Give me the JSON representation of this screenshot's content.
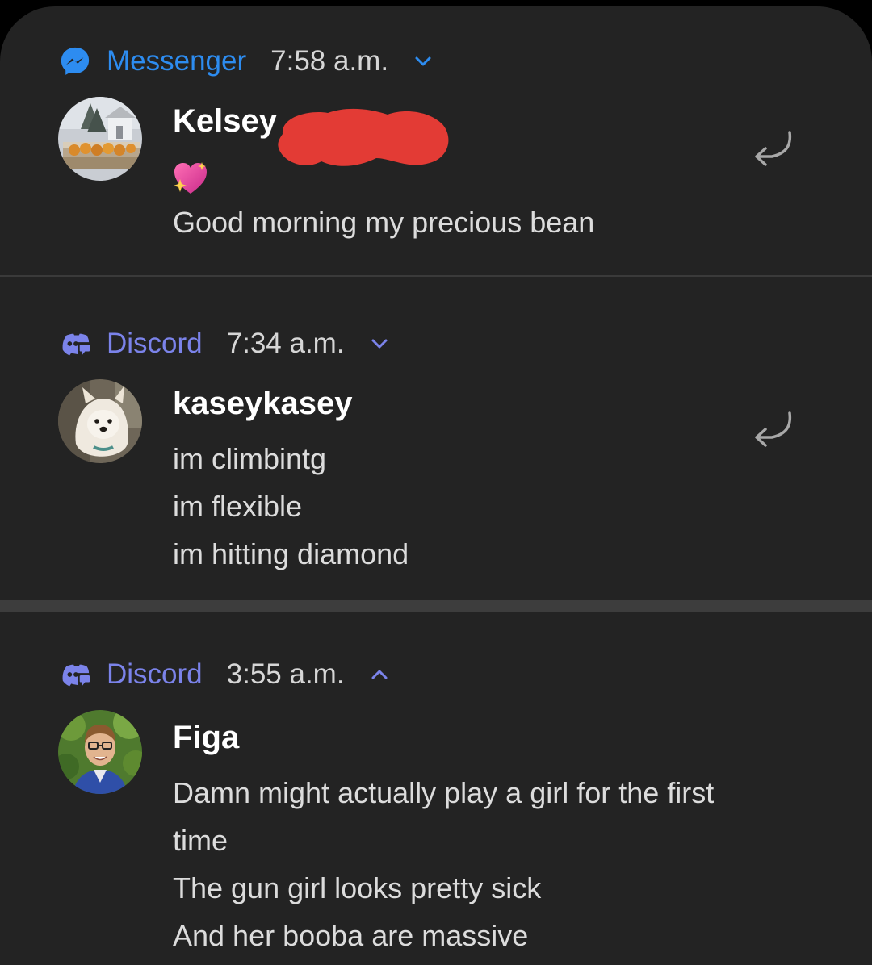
{
  "notifications": [
    {
      "app": "Messenger",
      "app_icon": "messenger-icon",
      "time": "7:58 a.m.",
      "expanded": false,
      "sender": "Kelsey",
      "sender_redacted": true,
      "emoji": "sparkling-heart",
      "lines": [
        "Good morning  my precious  bean"
      ],
      "accent_color": "#2d8cf0"
    },
    {
      "app": "Discord",
      "app_icon": "discord-icon",
      "time": "7:34 a.m.",
      "expanded": false,
      "sender": "kaseykasey",
      "lines": [
        "im climbintg",
        "im flexible",
        "im hitting diamond"
      ],
      "accent_color": "#7b83ea"
    },
    {
      "app": "Discord",
      "app_icon": "discord-icon",
      "time": "3:55 a.m.",
      "expanded": true,
      "sender": "Figa",
      "lines": [
        "Damn might actually play a girl for the first",
        "time",
        "The gun girl looks pretty sick",
        "And her booba are massive"
      ],
      "accent_color": "#7b83ea"
    }
  ],
  "colors": {
    "background": "#232323",
    "text_primary": "#ffffff",
    "text_secondary": "#dcdcdc"
  }
}
